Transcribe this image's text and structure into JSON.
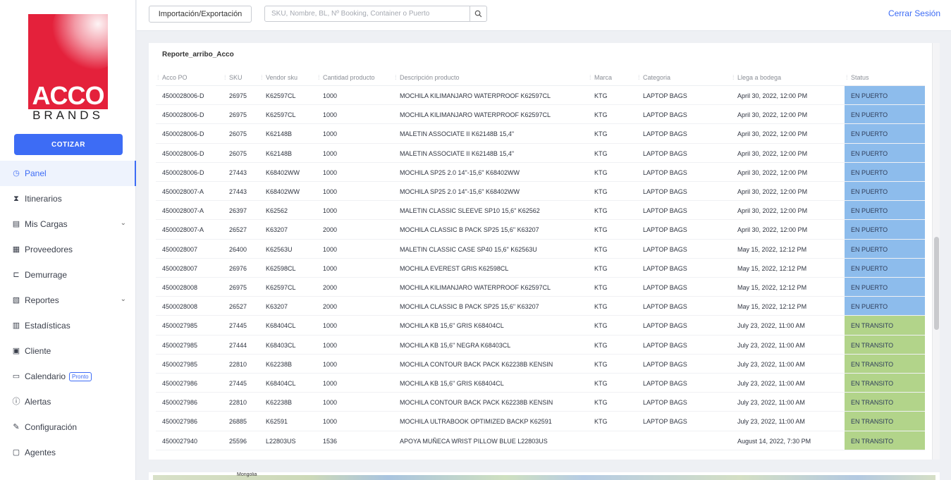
{
  "brand": {
    "name": "ACCO",
    "sub": "BRANDS"
  },
  "sidebar": {
    "cotizar_label": "COTIZAR",
    "items": [
      {
        "label": "Panel",
        "icon": "panel-icon",
        "active": true
      },
      {
        "label": "Itinerarios",
        "icon": "hourglass-icon"
      },
      {
        "label": "Mis Cargas",
        "icon": "cargo-icon",
        "expandable": true
      },
      {
        "label": "Proveedores",
        "icon": "store-icon"
      },
      {
        "label": "Demurrage",
        "icon": "demurrage-icon"
      },
      {
        "label": "Reportes",
        "icon": "reports-icon",
        "expandable": true
      },
      {
        "label": "Estadísticas",
        "icon": "stats-icon"
      },
      {
        "label": "Cliente",
        "icon": "client-icon"
      },
      {
        "label": "Calendario",
        "icon": "calendar-icon",
        "badge": "Pronto"
      },
      {
        "label": "Alertas",
        "icon": "alert-icon"
      },
      {
        "label": "Configuración",
        "icon": "wrench-icon"
      },
      {
        "label": "Agentes",
        "icon": "agents-icon"
      }
    ]
  },
  "topbar": {
    "import_export_label": "Importación/Exportación",
    "search_placeholder": "SKU, Nombre, BL, Nº Booking, Container o Puerto",
    "logout_label": "Cerrar Sesión"
  },
  "report": {
    "title": "Reporte_arribo_Acco",
    "columns": [
      "Acco PO",
      "SKU",
      "Vendor sku",
      "Cantidad producto",
      "Descripción producto",
      "Marca",
      "Categoria",
      "Llega a bodega",
      "Status"
    ],
    "rows": [
      [
        "4500028006-D",
        "26975",
        "K62597CL",
        "1000",
        "MOCHILA KILIMANJARO WATERPROOF K62597CL",
        "KTG",
        "LAPTOP BAGS",
        "April 30, 2022, 12:00 PM",
        "EN PUERTO"
      ],
      [
        "4500028006-D",
        "26975",
        "K62597CL",
        "1000",
        "MOCHILA KILIMANJARO WATERPROOF K62597CL",
        "KTG",
        "LAPTOP BAGS",
        "April 30, 2022, 12:00 PM",
        "EN PUERTO"
      ],
      [
        "4500028006-D",
        "26075",
        "K62148B",
        "1000",
        "MALETIN ASSOCIATE II K62148B 15,4\"",
        "KTG",
        "LAPTOP BAGS",
        "April 30, 2022, 12:00 PM",
        "EN PUERTO"
      ],
      [
        "4500028006-D",
        "26075",
        "K62148B",
        "1000",
        "MALETIN ASSOCIATE II K62148B 15,4\"",
        "KTG",
        "LAPTOP BAGS",
        "April 30, 2022, 12:00 PM",
        "EN PUERTO"
      ],
      [
        "4500028006-D",
        "27443",
        "K68402WW",
        "1000",
        "MOCHILA SP25 2.0 14\"-15,6\" K68402WW",
        "KTG",
        "LAPTOP BAGS",
        "April 30, 2022, 12:00 PM",
        "EN PUERTO"
      ],
      [
        "4500028007-A",
        "27443",
        "K68402WW",
        "1000",
        "MOCHILA SP25 2.0 14\"-15,6\" K68402WW",
        "KTG",
        "LAPTOP BAGS",
        "April 30, 2022, 12:00 PM",
        "EN PUERTO"
      ],
      [
        "4500028007-A",
        "26397",
        "K62562",
        "1000",
        "MALETIN CLASSIC SLEEVE SP10 15,6\" K62562",
        "KTG",
        "LAPTOP BAGS",
        "April 30, 2022, 12:00 PM",
        "EN PUERTO"
      ],
      [
        "4500028007-A",
        "26527",
        "K63207",
        "2000",
        "MOCHILA CLASSIC B PACK SP25 15,6\" K63207",
        "KTG",
        "LAPTOP BAGS",
        "April 30, 2022, 12:00 PM",
        "EN PUERTO"
      ],
      [
        "4500028007",
        "26400",
        "K62563U",
        "1000",
        "MALETIN CLASSIC CASE SP40 15,6\" K62563U",
        "KTG",
        "LAPTOP BAGS",
        "May 15, 2022, 12:12 PM",
        "EN PUERTO"
      ],
      [
        "4500028007",
        "26976",
        "K62598CL",
        "1000",
        "MOCHILA EVEREST GRIS K62598CL",
        "KTG",
        "LAPTOP BAGS",
        "May 15, 2022, 12:12 PM",
        "EN PUERTO"
      ],
      [
        "4500028008",
        "26975",
        "K62597CL",
        "2000",
        "MOCHILA KILIMANJARO WATERPROOF K62597CL",
        "KTG",
        "LAPTOP BAGS",
        "May 15, 2022, 12:12 PM",
        "EN PUERTO"
      ],
      [
        "4500028008",
        "26527",
        "K63207",
        "2000",
        "MOCHILA CLASSIC B PACK SP25 15,6\" K63207",
        "KTG",
        "LAPTOP BAGS",
        "May 15, 2022, 12:12 PM",
        "EN PUERTO"
      ],
      [
        "4500027985",
        "27445",
        "K68404CL",
        "1000",
        "MOCHILA KB 15,6\" GRIS K68404CL",
        "KTG",
        "LAPTOP BAGS",
        "July 23, 2022, 11:00 AM",
        "EN TRANSITO"
      ],
      [
        "4500027985",
        "27444",
        "K68403CL",
        "1000",
        "MOCHILA KB 15,6\" NEGRA K68403CL",
        "KTG",
        "LAPTOP BAGS",
        "July 23, 2022, 11:00 AM",
        "EN TRANSITO"
      ],
      [
        "4500027985",
        "22810",
        "K62238B",
        "1000",
        "MOCHILA CONTOUR BACK PACK K62238B KENSIN",
        "KTG",
        "LAPTOP BAGS",
        "July 23, 2022, 11:00 AM",
        "EN TRANSITO"
      ],
      [
        "4500027986",
        "27445",
        "K68404CL",
        "1000",
        "MOCHILA KB 15,6\" GRIS K68404CL",
        "KTG",
        "LAPTOP BAGS",
        "July 23, 2022, 11:00 AM",
        "EN TRANSITO"
      ],
      [
        "4500027986",
        "22810",
        "K62238B",
        "1000",
        "MOCHILA CONTOUR BACK PACK K62238B KENSIN",
        "KTG",
        "LAPTOP BAGS",
        "July 23, 2022, 11:00 AM",
        "EN TRANSITO"
      ],
      [
        "4500027986",
        "26885",
        "K62591",
        "1000",
        "MOCHILA ULTRABOOK OPTIMIZED BACKP K62591",
        "KTG",
        "LAPTOP BAGS",
        "July 23, 2022, 11:00 AM",
        "EN TRANSITO"
      ],
      [
        "4500027940",
        "25596",
        "L22803US",
        "1536",
        "APOYA MUÑECA WRIST PILLOW BLUE L22803US",
        "",
        "",
        "August 14, 2022, 7:30 PM",
        "EN TRANSITO"
      ]
    ]
  },
  "status_colors": {
    "EN PUERTO": "#8dbcec",
    "EN TRANSITO": "#b2d48a"
  },
  "map": {
    "label": "Mongolia"
  }
}
